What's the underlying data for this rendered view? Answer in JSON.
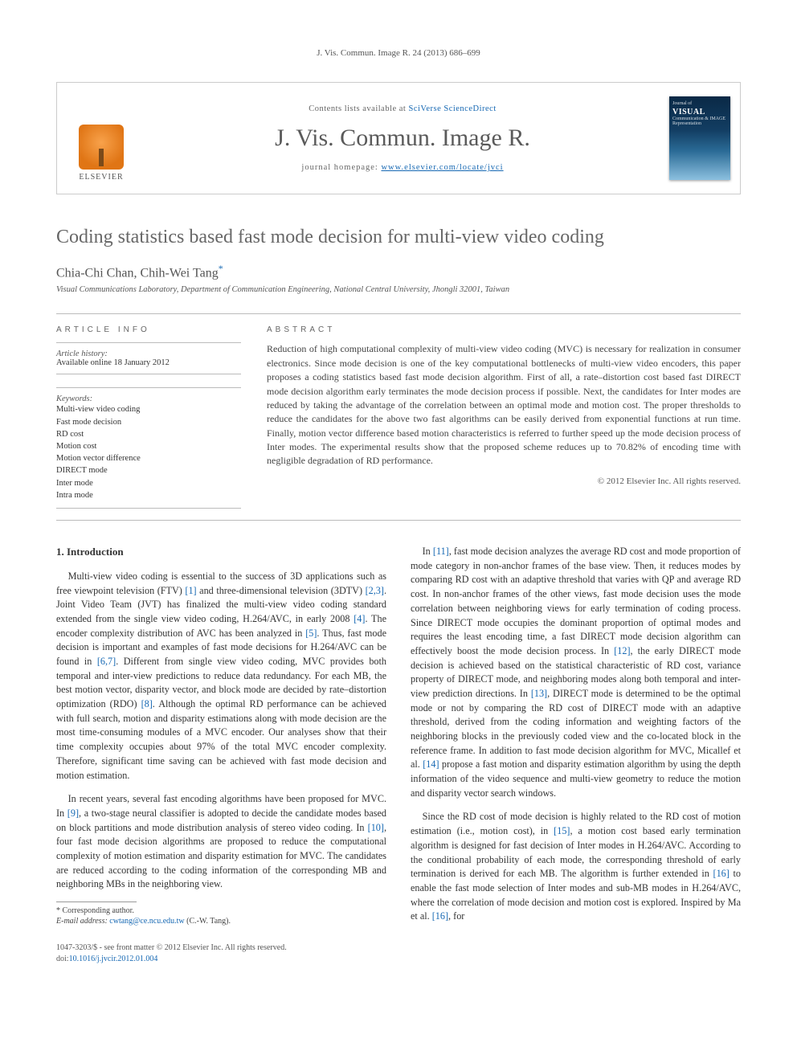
{
  "running_head": "J. Vis. Commun. Image R. 24 (2013) 686–699",
  "masthead": {
    "publisher": "ELSEVIER",
    "lists_prefix": "Contents lists available at ",
    "lists_link": "SciVerse ScienceDirect",
    "journal": "J. Vis. Commun. Image R.",
    "homepage_prefix": "journal homepage: ",
    "homepage_link": "www.elsevier.com/locate/jvci",
    "cover_top": "Journal of",
    "cover_title": "VISUAL",
    "cover_sub": "Communication & IMAGE Representation"
  },
  "article": {
    "title": "Coding statistics based fast mode decision for multi-view video coding",
    "authors": "Chia-Chi Chan, Chih-Wei Tang",
    "corr_symbol": "*",
    "affiliation": "Visual Communications Laboratory, Department of Communication Engineering, National Central University, Jhongli 32001, Taiwan"
  },
  "labels": {
    "article_info": "ARTICLE INFO",
    "abstract": "ABSTRACT",
    "history": "Article history:",
    "keywords": "Keywords:"
  },
  "history": {
    "available": "Available online 18 January 2012"
  },
  "keywords": [
    "Multi-view video coding",
    "Fast mode decision",
    "RD cost",
    "Motion cost",
    "Motion vector difference",
    "DIRECT mode",
    "Inter mode",
    "Intra mode"
  ],
  "abstract": "Reduction of high computational complexity of multi-view video coding (MVC) is necessary for realization in consumer electronics. Since mode decision is one of the key computational bottlenecks of multi-view video encoders, this paper proposes a coding statistics based fast mode decision algorithm. First of all, a rate–distortion cost based fast DIRECT mode decision algorithm early terminates the mode decision process if possible. Next, the candidates for Inter modes are reduced by taking the advantage of the correlation between an optimal mode and motion cost. The proper thresholds to reduce the candidates for the above two fast algorithms can be easily derived from exponential functions at run time. Finally, motion vector difference based motion characteristics is referred to further speed up the mode decision process of Inter modes. The experimental results show that the proposed scheme reduces up to 70.82% of encoding time with negligible degradation of RD performance.",
  "copyright": "© 2012 Elsevier Inc. All rights reserved.",
  "section1_heading": "1. Introduction",
  "body": {
    "p1": "Multi-view video coding is essential to the success of 3D applications such as free viewpoint television (FTV) [1] and three-dimensional television (3DTV) [2,3]. Joint Video Team (JVT) has finalized the multi-view video coding standard extended from the single view video coding, H.264/AVC, in early 2008 [4]. The encoder complexity distribution of AVC has been analyzed in [5]. Thus, fast mode decision is important and examples of fast mode decisions for H.264/AVC can be found in [6,7]. Different from single view video coding, MVC provides both temporal and inter-view predictions to reduce data redundancy. For each MB, the best motion vector, disparity vector, and block mode are decided by rate–distortion optimization (RDO) [8]. Although the optimal RD performance can be achieved with full search, motion and disparity estimations along with mode decision are the most time-consuming modules of a MVC encoder. Our analyses show that their time complexity occupies about 97% of the total MVC encoder complexity. Therefore, significant time saving can be achieved with fast mode decision and motion estimation.",
    "p2": "In recent years, several fast encoding algorithms have been proposed for MVC. In [9], a two-stage neural classifier is adopted to decide the candidate modes based on block partitions and mode distribution analysis of stereo video coding. In [10], four fast mode decision algorithms are proposed to reduce the computational complexity of motion estimation and disparity estimation for MVC. The candidates are reduced according to the coding information of the corresponding MB and neighboring MBs in the neighboring view.",
    "p3": "In [11], fast mode decision analyzes the average RD cost and mode proportion of mode category in non-anchor frames of the base view. Then, it reduces modes by comparing RD cost with an adaptive threshold that varies with QP and average RD cost. In non-anchor frames of the other views, fast mode decision uses the mode correlation between neighboring views for early termination of coding process. Since DIRECT mode occupies the dominant proportion of optimal modes and requires the least encoding time, a fast DIRECT mode decision algorithm can effectively boost the mode decision process. In [12], the early DIRECT mode decision is achieved based on the statistical characteristic of RD cost, variance property of DIRECT mode, and neighboring modes along both temporal and inter-view prediction directions. In [13], DIRECT mode is determined to be the optimal mode or not by comparing the RD cost of DIRECT mode with an adaptive threshold, derived from the coding information and weighting factors of the neighboring blocks in the previously coded view and the co-located block in the reference frame. In addition to fast mode decision algorithm for MVC, Micallef et al. [14] propose a fast motion and disparity estimation algorithm by using the depth information of the video sequence and multi-view geometry to reduce the motion and disparity vector search windows.",
    "p4": "Since the RD cost of mode decision is highly related to the RD cost of motion estimation (i.e., motion cost), in [15], a motion cost based early termination algorithm is designed for fast decision of Inter modes in H.264/AVC. According to the conditional probability of each mode, the corresponding threshold of early termination is derived for each MB. The algorithm is further extended in [16] to enable the fast mode selection of Inter modes and sub-MB modes in H.264/AVC, where the correlation of mode decision and motion cost is explored. Inspired by Ma et al. [16], for"
  },
  "footnote": {
    "corr": "* Corresponding author.",
    "email_label": "E-mail address: ",
    "email": "cwtang@ce.ncu.edu.tw",
    "email_who": " (C.-W. Tang)."
  },
  "bottom": {
    "issn_line": "1047-3203/$ - see front matter © 2012 Elsevier Inc. All rights reserved.",
    "doi_label": "doi:",
    "doi": "10.1016/j.jvcir.2012.01.004"
  }
}
